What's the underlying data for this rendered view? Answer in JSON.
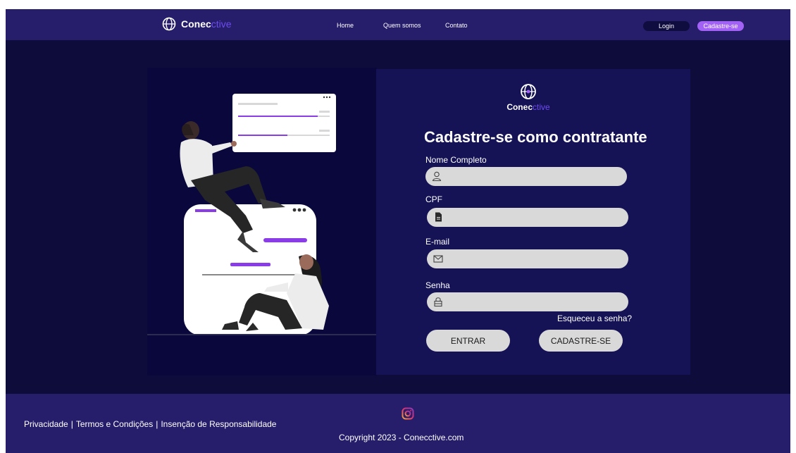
{
  "header": {
    "brand_main": "Conec",
    "brand_accent": "ctive",
    "nav": [
      "Home",
      "Quem somos",
      "Contato"
    ],
    "login_label": "Login",
    "signup_label": "Cadastre-se"
  },
  "form": {
    "brand_main": "Conec",
    "brand_accent": "ctive",
    "title": "Cadastre-se como contratante",
    "fields": [
      {
        "label": "Nome Completo",
        "icon": "user-icon",
        "value": ""
      },
      {
        "label": "CPF",
        "icon": "document-icon",
        "value": ""
      },
      {
        "label": "E-mail",
        "icon": "envelope-icon",
        "value": ""
      },
      {
        "label": "Senha",
        "icon": "lock-icon",
        "value": ""
      }
    ],
    "forgot_password": "Esqueceu a senha?",
    "enter_label": "ENTRAR",
    "register_label": "CADASTRE-SE"
  },
  "footer": {
    "links": [
      "Privacidade",
      "Termos e Condições",
      "Insenção de Responsabilidade"
    ],
    "separator": "|",
    "social_icon": "instagram-icon",
    "copyright": "Copyright 2023 - Conecctive.com"
  },
  "colors": {
    "header_bg": "#261e6b",
    "page_bg": "#0e0c3a",
    "panel_bg": "#151355",
    "accent": "#a262f5",
    "field_bg": "#d9d9d9"
  }
}
